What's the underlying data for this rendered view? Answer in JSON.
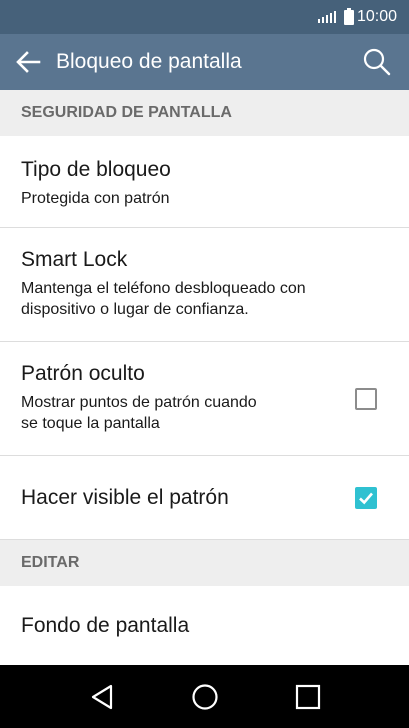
{
  "status_bar": {
    "time": "10:00"
  },
  "app_bar": {
    "title": "Bloqueo de pantalla"
  },
  "sections": {
    "security_header": "SEGURIDAD DE PANTALLA",
    "edit_header": "EDITAR"
  },
  "items": {
    "lock_type": {
      "title": "Tipo de bloqueo",
      "summary": "Protegida con patrón"
    },
    "smart_lock": {
      "title": "Smart Lock",
      "summary_line1": "Mantenga el teléfono desbloqueado con",
      "summary_line2": "dispositivo o lugar de confianza."
    },
    "hidden_pattern": {
      "title": "Patrón oculto",
      "summary_line1": "Mostrar puntos de patrón cuando",
      "summary_line2": "se toque la pantalla",
      "checked": false
    },
    "visible_pattern": {
      "title": "Hacer visible el patrón",
      "checked": true
    },
    "wallpaper": {
      "title": "Fondo de pantalla"
    }
  },
  "colors": {
    "status_bar": "#46617a",
    "app_bar": "#5a7590",
    "checkbox_accent": "#2fc1d1",
    "section_bg": "#eeeeee"
  },
  "icons": {
    "back": "arrow-left-icon",
    "search": "search-icon",
    "nav_back": "triangle-back-icon",
    "nav_home": "circle-home-icon",
    "nav_recents": "square-recents-icon"
  }
}
